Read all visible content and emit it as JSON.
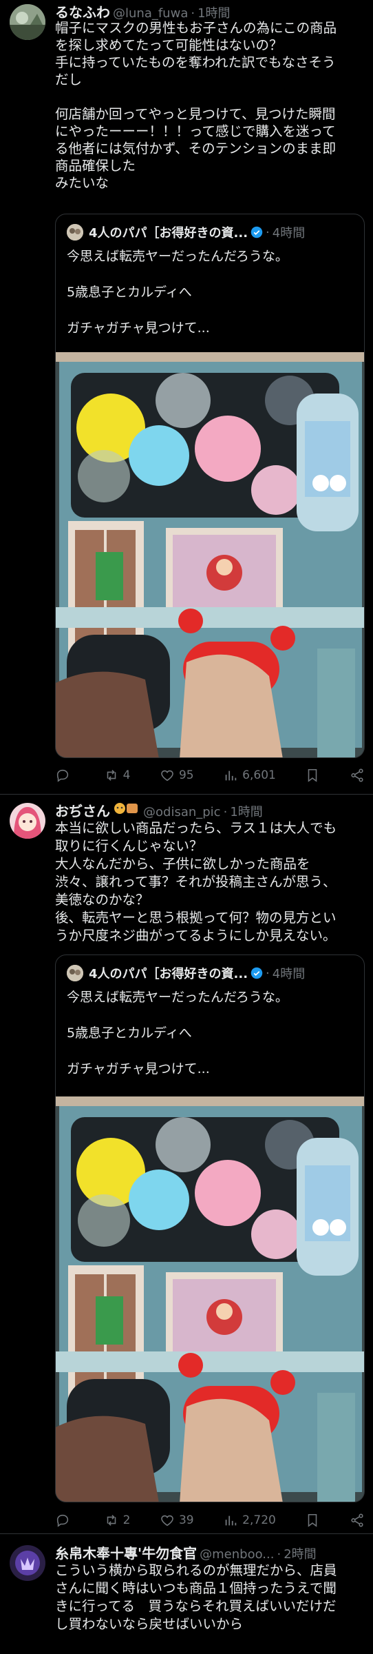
{
  "tweets": [
    {
      "name": "るなふわ",
      "handle": "@luna_fuwa",
      "dot": "·",
      "time": "1時間",
      "lines": [
        "帽子にマスクの男性もお子さんの為にこの商品",
        "を探し求めてたって可能性はないの？",
        "手に持っていたものを奪われた訳でもなさそう",
        "だし",
        "",
        "何店舗か回ってやっと見つけて、見つけた瞬間",
        "にやったーーー！！！って感じで購入を迷って",
        "る他者には気付かず、そのテンションのまま即",
        "商品確保した",
        "みたいな"
      ],
      "quote": {
        "name": "4人のパパ［お得好きの資...",
        "dot": "·",
        "time": "4時間",
        "lines": [
          "今思えば転売ヤーだったんだろうな。",
          "",
          "5歳息子とカルディへ",
          "",
          "ガチャガチャ見つけて..."
        ]
      },
      "stats": {
        "replies": "",
        "retweets": "4",
        "likes": "95",
        "views": "6,601"
      }
    },
    {
      "name": "おぢさん",
      "handle": "@odisan_pic",
      "dot": "·",
      "time": "1時間",
      "lines": [
        "本当に欲しい商品だったら、ラス１は大人でも",
        "取りに行くんじゃない？",
        "大人なんだから、子供に欲しかった商品を",
        "渋々、譲れって事？それが投稿主さんが思う、",
        "美徳なのかな？",
        "後、転売ヤーと思う根拠って何？物の見方とい",
        "うか尺度ネジ曲がってるようにしか見えない。"
      ],
      "quote": {
        "name": "4人のパパ［お得好きの資...",
        "dot": "·",
        "time": "4時間",
        "lines": [
          "今思えば転売ヤーだったんだろうな。",
          "",
          "5歳息子とカルディへ",
          "",
          "ガチャガチャ見つけて..."
        ]
      },
      "stats": {
        "replies": "",
        "retweets": "2",
        "likes": "39",
        "views": "2,720"
      }
    },
    {
      "name": "糸帛木奉十專'牛勿食官",
      "handle": "@menboo...",
      "dot": "·",
      "time": "2時間",
      "lines": [
        "こういう横から取られるのが無理だから、店員",
        "さんに聞く時はいつも商品１個持ったうえで聞",
        "きに行ってる　買うならそれ買えばいいだけだ",
        "し買わないなら戻せばいいから"
      ]
    }
  ],
  "colors": {
    "background": "#000000",
    "text": "#e7e9ea",
    "secondary": "#71767b",
    "border": "#2f3336",
    "verified": "#1d9bf0"
  }
}
